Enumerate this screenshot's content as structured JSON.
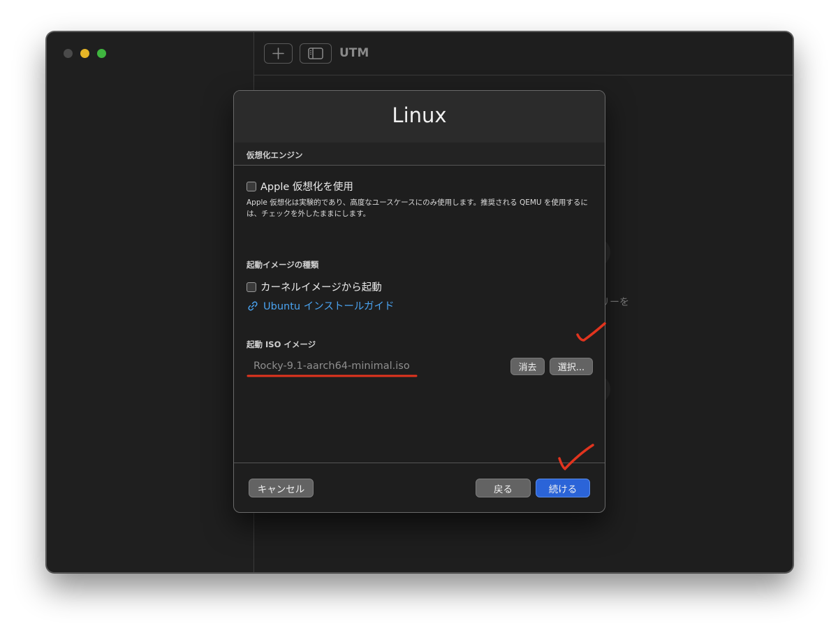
{
  "window": {
    "toolbar_title": "UTM",
    "background_hint": "リーを"
  },
  "dialog": {
    "title": "Linux",
    "virtualization_section": "仮想化エンジン",
    "apple_checkbox_label": "Apple 仮想化を使用",
    "apple_checkbox_checked": false,
    "apple_description": "Apple 仮想化は実験的であり、高度なユースケースにのみ使用します。推奨される QEMU を使用するには、チェックを外したままにします。",
    "boot_type_section": "起動イメージの種類",
    "kernel_checkbox_label": "カーネルイメージから起動",
    "kernel_checkbox_checked": false,
    "ubuntu_guide_link": "Ubuntu インストールガイド",
    "boot_iso_section": "起動 ISO イメージ",
    "iso_value": "Rocky-9.1-aarch64-minimal.iso",
    "clear_button": "消去",
    "select_button": "選択...",
    "cancel_button": "キャンセル",
    "back_button": "戻る",
    "continue_button": "続ける"
  },
  "colors": {
    "accent": "#2b64d8",
    "link": "#4aa3f0",
    "annotation": "#e1341e"
  }
}
